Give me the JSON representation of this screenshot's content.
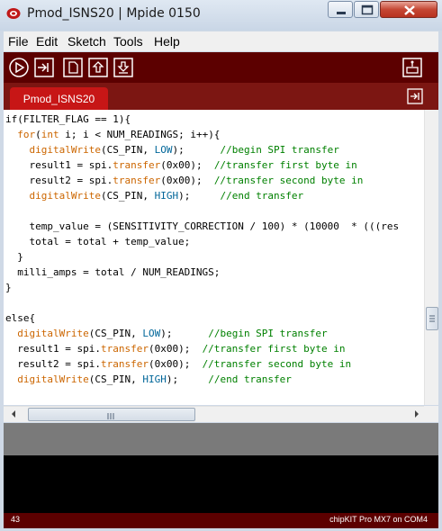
{
  "window": {
    "title": "Pmod_ISNS20 | Mpide 0150"
  },
  "menu": [
    "File",
    "Edit",
    "Sketch",
    "Tools",
    "Help"
  ],
  "toolbar": {
    "icons": [
      "verify-icon",
      "upload-icon",
      "new-icon",
      "open-icon",
      "save-icon",
      "serial-monitor-icon"
    ]
  },
  "tabs": [
    {
      "label": "Pmod_ISNS20",
      "active": true
    }
  ],
  "code_lines": [
    [
      {
        "t": "if(FILTER_FLAG == 1){"
      }
    ],
    [
      {
        "t": "  "
      },
      {
        "t": "for",
        "c": "kw"
      },
      {
        "t": "("
      },
      {
        "t": "int",
        "c": "kw"
      },
      {
        "t": " i; i < NUM_READINGS; i++){"
      }
    ],
    [
      {
        "t": "    "
      },
      {
        "t": "digitalWrite",
        "c": "kw"
      },
      {
        "t": "(CS_PIN, "
      },
      {
        "t": "LOW",
        "c": "cst"
      },
      {
        "t": ");      "
      },
      {
        "t": "//begin SPI transfer",
        "c": "cm"
      }
    ],
    [
      {
        "t": "    result1 = spi."
      },
      {
        "t": "transfer",
        "c": "kw"
      },
      {
        "t": "(0x00);  "
      },
      {
        "t": "//transfer first byte in",
        "c": "cm"
      }
    ],
    [
      {
        "t": "    result2 = spi."
      },
      {
        "t": "transfer",
        "c": "kw"
      },
      {
        "t": "(0x00);  "
      },
      {
        "t": "//transfer second byte in",
        "c": "cm"
      }
    ],
    [
      {
        "t": "    "
      },
      {
        "t": "digitalWrite",
        "c": "kw"
      },
      {
        "t": "(CS_PIN, "
      },
      {
        "t": "HIGH",
        "c": "cst"
      },
      {
        "t": ");     "
      },
      {
        "t": "//end transfer",
        "c": "cm"
      }
    ],
    [
      {
        "t": ""
      }
    ],
    [
      {
        "t": "    temp_value = (SENSITIVITY_CORRECTION / 100) * (10000  * (((res"
      }
    ],
    [
      {
        "t": "    total = total + temp_value;"
      }
    ],
    [
      {
        "t": "  }"
      }
    ],
    [
      {
        "t": "  milli_amps = total / NUM_READINGS;"
      }
    ],
    [
      {
        "t": "}"
      }
    ],
    [
      {
        "t": ""
      }
    ],
    [
      {
        "t": "else{"
      }
    ],
    [
      {
        "t": "  "
      },
      {
        "t": "digitalWrite",
        "c": "kw"
      },
      {
        "t": "(CS_PIN, "
      },
      {
        "t": "LOW",
        "c": "cst"
      },
      {
        "t": ");      "
      },
      {
        "t": "//begin SPI transfer",
        "c": "cm"
      }
    ],
    [
      {
        "t": "  result1 = spi."
      },
      {
        "t": "transfer",
        "c": "kw"
      },
      {
        "t": "(0x00);  "
      },
      {
        "t": "//transfer first byte in",
        "c": "cm"
      }
    ],
    [
      {
        "t": "  result2 = spi."
      },
      {
        "t": "transfer",
        "c": "kw"
      },
      {
        "t": "(0x00);  "
      },
      {
        "t": "//transfer second byte in",
        "c": "cm"
      }
    ],
    [
      {
        "t": "  "
      },
      {
        "t": "digitalWrite",
        "c": "kw"
      },
      {
        "t": "(CS_PIN, "
      },
      {
        "t": "HIGH",
        "c": "cst"
      },
      {
        "t": ");     "
      },
      {
        "t": "//end transfer",
        "c": "cm"
      }
    ]
  ],
  "status_bar": {
    "line_number": "43",
    "board": "chipKIT Pro MX7 on COM4"
  },
  "colors": {
    "toolbar": "#5c0000",
    "tab_active": "#c71616",
    "keyword": "#cc6600",
    "constant": "#006699",
    "comment": "#008000"
  }
}
